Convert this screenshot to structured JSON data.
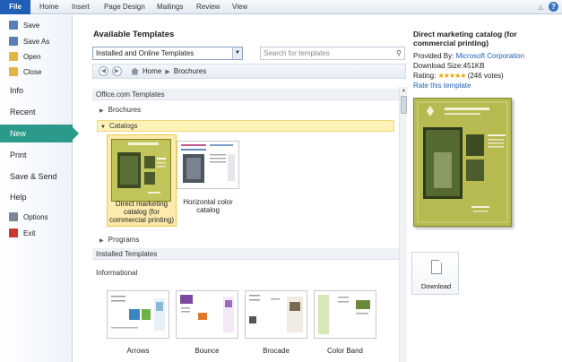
{
  "ribbon": {
    "file_tab": "File",
    "tabs": [
      "Home",
      "Insert",
      "Page Design",
      "Mailings",
      "Review",
      "View"
    ]
  },
  "backstage": {
    "items": [
      {
        "label": "Save",
        "icon": "save-icon"
      },
      {
        "label": "Save As",
        "icon": "save-as-icon"
      },
      {
        "label": "Open",
        "icon": "open-icon"
      },
      {
        "label": "Close",
        "icon": "close-icon"
      }
    ],
    "sections": [
      "Info",
      "Recent",
      "New",
      "Print",
      "Save & Send",
      "Help"
    ],
    "options": "Options",
    "exit": "Exit",
    "active": "New"
  },
  "templates": {
    "title": "Available Templates",
    "source_select": "Installed and Online Templates",
    "search_placeholder": "Search for templates",
    "breadcrumb": [
      "Home",
      "Brochures"
    ],
    "office_header": "Office.com Templates",
    "categories": [
      "Brochures",
      "Catalogs",
      "Programs"
    ],
    "selected_category": "Catalogs",
    "catalog_items": [
      {
        "caption": "Direct marketing catalog (for commercial printing)"
      },
      {
        "caption": "Horizontal color catalog"
      }
    ],
    "installed_header": "Installed Templates",
    "installed_group": "Informational",
    "installed_items": [
      "Arrows",
      "Bounce",
      "Brocade",
      "Color Band"
    ]
  },
  "preview": {
    "title": "Direct marketing catalog (for commercial printing)",
    "provided_by_label": "Provided By:",
    "provider": "Microsoft Corporation",
    "download_size": "Download Size:451KB",
    "rating_label": "Rating:",
    "rating_stars": 5,
    "votes": "(246 votes)",
    "rate_link": "Rate this template",
    "download_label": "Download"
  },
  "colors": {
    "file_tab": "#1f5fb5",
    "new_highlight": "#2b9a8b",
    "selected_category": "#fdf2b8",
    "catalog_green": "#b6ba50"
  }
}
